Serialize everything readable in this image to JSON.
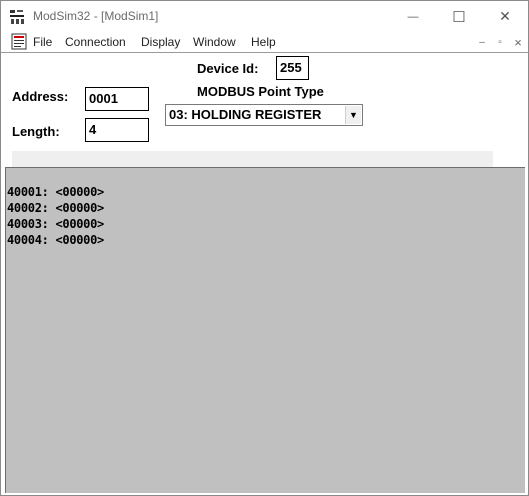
{
  "window": {
    "title": "ModSim32 - [ModSim1]",
    "controls": {
      "minimize": "—",
      "maximize": "☐",
      "close": "✕"
    }
  },
  "menubar": {
    "items": [
      "File",
      "Connection",
      "Display",
      "Window",
      "Help"
    ],
    "mdi_controls": {
      "minimize": "–",
      "restore": "▫",
      "close": "×"
    }
  },
  "form": {
    "device_id_label": "Device Id:",
    "device_id_value": "255",
    "point_type_label": "MODBUS Point Type",
    "point_type_selected": "03: HOLDING REGISTER",
    "address_label": "Address:",
    "address_value": "0001",
    "length_label": "Length:",
    "length_value": "4"
  },
  "registers": [
    "40001: <00000>",
    "40002: <00000>",
    "40003: <00000>",
    "40004: <00000>"
  ],
  "colors": {
    "display_background": "#c0c0c0",
    "title_text": "#6b6b6b"
  }
}
